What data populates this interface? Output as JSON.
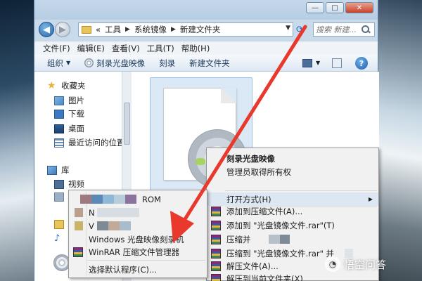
{
  "toolbar_address": {
    "breadcrumbs": [
      "«",
      "工具",
      "系统镜像",
      "新建文件夹"
    ],
    "search_placeholder": "搜索 新建..."
  },
  "window_buttons": {
    "minimize": "—",
    "maximize": "□",
    "close": "✕"
  },
  "menubar": [
    "文件(F)",
    "编辑(E)",
    "查看(V)",
    "工具(T)",
    "帮助(H)"
  ],
  "toolbar": {
    "organize": "组织",
    "burn_image": "刻录光盘映像",
    "burn": "刻录",
    "new_folder": "新建文件夹",
    "help": "?"
  },
  "navpane": {
    "favorites": "收藏夹",
    "items": [
      "图片",
      "下载",
      "桌面",
      "最近访问的位置"
    ],
    "libraries": "库",
    "lib_items": [
      "视频"
    ]
  },
  "context_menu": {
    "items": [
      {
        "label": "刻录光盘映像",
        "bold": true
      },
      {
        "label": "管理员取得所有权"
      },
      {
        "label": "打开方式(H)",
        "submenu": true
      },
      {
        "label": "添加到压缩文件(A)..."
      },
      {
        "label": "添加到 \"光盘镜像文件.rar\"(T)"
      },
      {
        "label": "压缩并"
      },
      {
        "label": "压缩到 \"光盘镜像文件.rar\" 并"
      },
      {
        "label": "解压文件(A)..."
      },
      {
        "label": "解压到当前文件夹(X)"
      }
    ]
  },
  "openwith_menu": {
    "items": [
      {
        "label": "ROM"
      },
      {
        "label": "N"
      },
      {
        "label": "V"
      },
      {
        "label": "Windows 光盘映像刻录机"
      },
      {
        "label": "WinRAR 压缩文件管理器"
      },
      {
        "label": "选择默认程序(C)..."
      }
    ]
  },
  "watermark": {
    "text": "悟空问答"
  },
  "colors": {
    "arrow": "#e8392c",
    "accent": "#3c78c2"
  }
}
